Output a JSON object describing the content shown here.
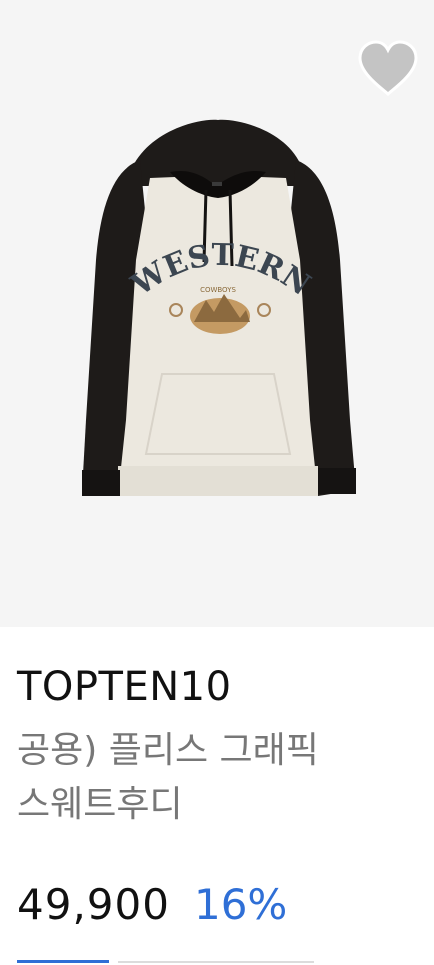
{
  "product": {
    "image_alt": "공용) 플리스 그래픽 스웨트후디",
    "print_text": "WESTERN",
    "print_subtext": "COWBOYS",
    "brand": "TOPTEN10",
    "name_line1": "공용) 플리스 그래픽",
    "name_line2": "스웨트후디",
    "price": "49,900",
    "discount": "16%"
  },
  "icons": {
    "wishlist": "heart-icon"
  },
  "colors": {
    "accent": "#2f6fd6",
    "image_background": "#f5f5f5",
    "heart": "#c4c4c4",
    "text_primary": "#111111",
    "text_secondary": "#777777"
  }
}
